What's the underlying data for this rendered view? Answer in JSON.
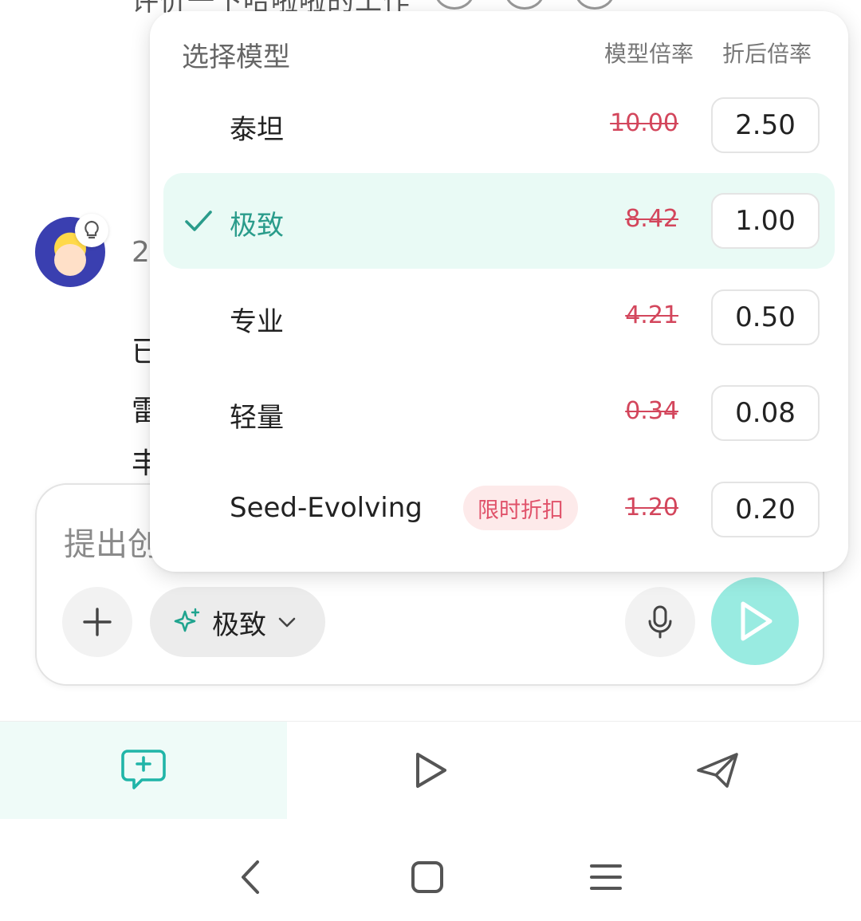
{
  "background_chat": {
    "top_text": "评价一下哈啦啦的工作",
    "number_fragment": "2",
    "text_fragments": [
      "已",
      "雷",
      "丰"
    ]
  },
  "composer": {
    "placeholder": "提出创",
    "model_pill_label": "极致"
  },
  "model_picker": {
    "title": "选择模型",
    "col_model_rate": "模型倍率",
    "col_discount_rate": "折后倍率",
    "rows": [
      {
        "name": "泰坦",
        "original": "10.00",
        "discounted": "2.50",
        "selected": false
      },
      {
        "name": "极致",
        "original": "8.42",
        "discounted": "1.00",
        "selected": true
      },
      {
        "name": "专业",
        "original": "4.21",
        "discounted": "0.50",
        "selected": false
      },
      {
        "name": "轻量",
        "original": "0.34",
        "discounted": "0.08",
        "selected": false
      },
      {
        "name": "Seed-Evolving",
        "tag": "限时折扣",
        "original": "1.20",
        "discounted": "0.20",
        "selected": false
      }
    ]
  },
  "bottom_nav": {
    "items": [
      {
        "icon": "new-chat-icon",
        "active": true
      },
      {
        "icon": "play-icon",
        "active": false
      },
      {
        "icon": "send-paper-plane-icon",
        "active": false
      }
    ]
  },
  "colors": {
    "accent": "#2a9c8b",
    "selected_bg": "#e9faf5",
    "strike_red": "#d3465c",
    "send_button": "#99ebe1",
    "promo_tag_bg": "#fdeaea"
  }
}
